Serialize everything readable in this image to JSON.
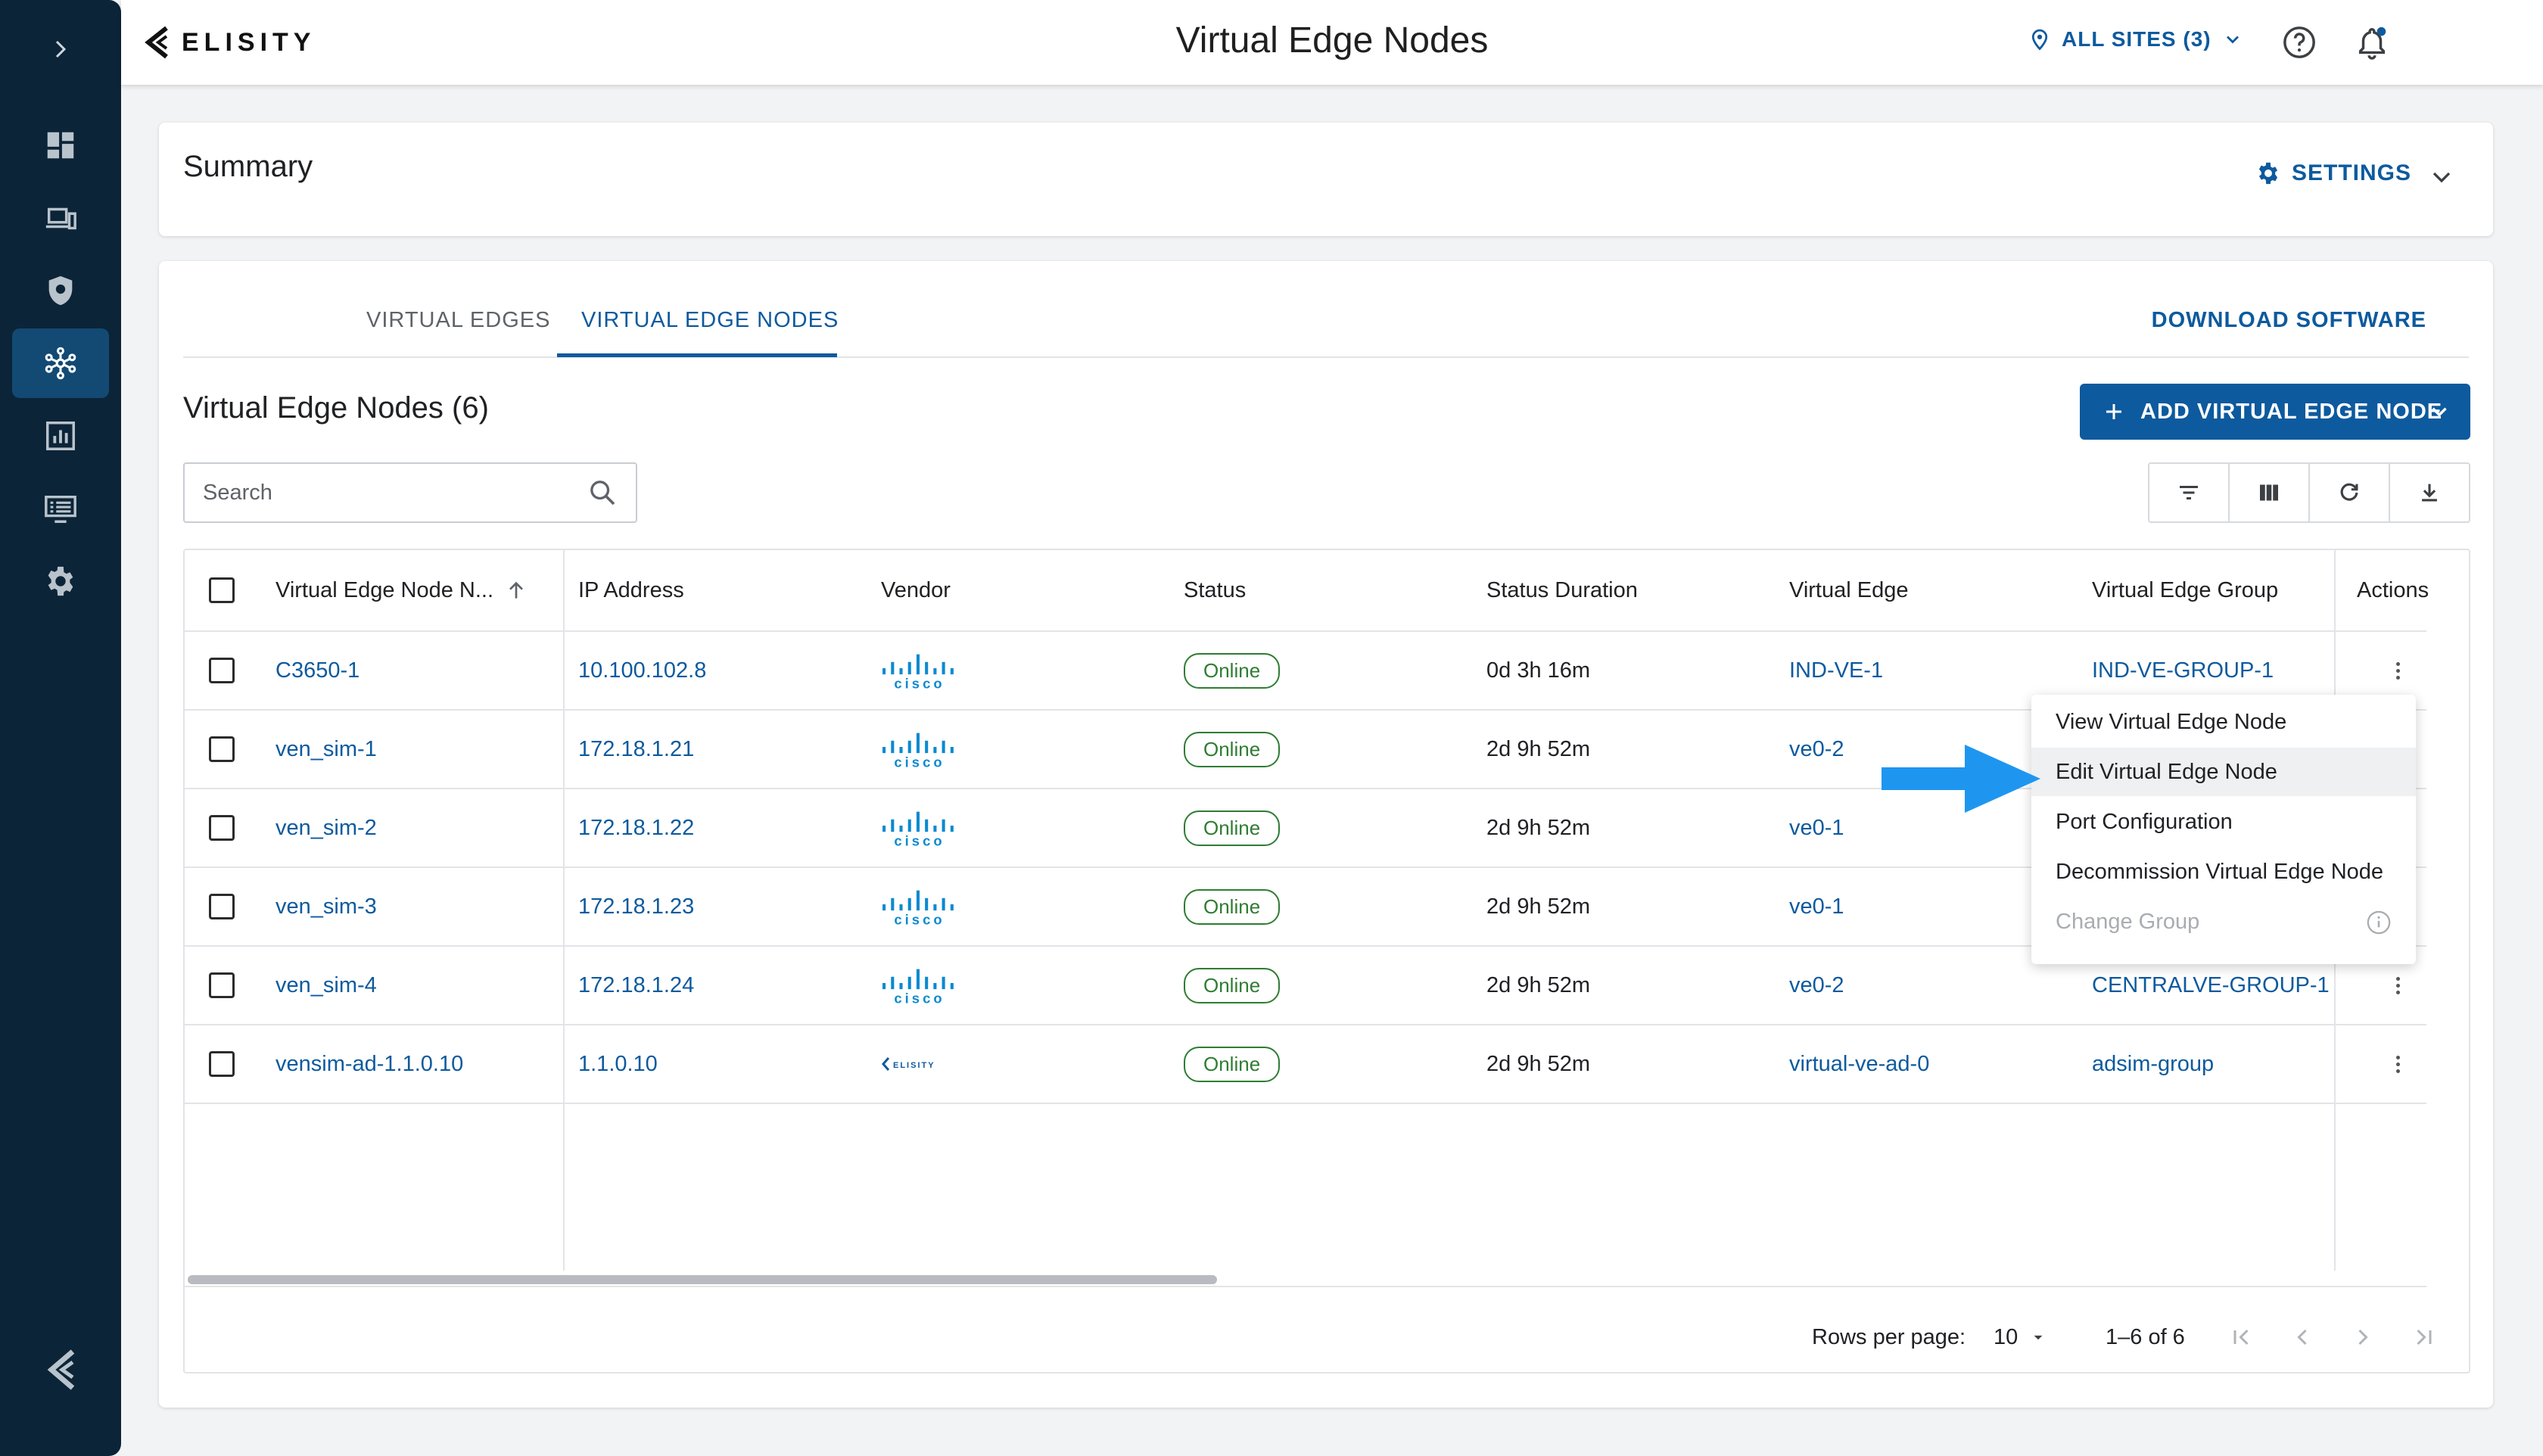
{
  "app": {
    "brand": "ELISITY",
    "page_title": "Virtual Edge Nodes",
    "sites_label": "ALL SITES (3)"
  },
  "sidebar": {
    "items": [
      {
        "name": "dashboard",
        "icon": "dashboard-icon",
        "active": false
      },
      {
        "name": "devices",
        "icon": "devices-icon",
        "active": false
      },
      {
        "name": "policies",
        "icon": "shield-icon",
        "active": false
      },
      {
        "name": "network",
        "icon": "network-icon",
        "active": true
      },
      {
        "name": "analytics",
        "icon": "analytics-icon",
        "active": false
      },
      {
        "name": "logs",
        "icon": "logs-icon",
        "active": false
      },
      {
        "name": "settings",
        "icon": "gear-icon",
        "active": false
      }
    ]
  },
  "summary": {
    "title": "Summary",
    "settings_label": "SETTINGS"
  },
  "tabs": [
    {
      "label": "VIRTUAL EDGES",
      "active": false
    },
    {
      "label": "VIRTUAL EDGE NODES",
      "active": true
    }
  ],
  "download_label": "DOWNLOAD SOFTWARE",
  "list": {
    "title": "Virtual Edge Nodes (6)",
    "add_button_label": "ADD VIRTUAL EDGE NODE",
    "search_placeholder": "Search"
  },
  "table": {
    "columns": [
      "Virtual Edge Node N...",
      "IP Address",
      "Vendor",
      "Status",
      "Status Duration",
      "Virtual Edge",
      "Virtual Edge Group",
      "Actions"
    ],
    "rows": [
      {
        "name": "C3650-1",
        "ip": "10.100.102.8",
        "vendor": "cisco",
        "status": "Online",
        "duration": "0d 3h 16m",
        "edge": "IND-VE-1",
        "group": "IND-VE-GROUP-1"
      },
      {
        "name": "ven_sim-1",
        "ip": "172.18.1.21",
        "vendor": "cisco",
        "status": "Online",
        "duration": "2d 9h 52m",
        "edge": "ve0-2",
        "group": ""
      },
      {
        "name": "ven_sim-2",
        "ip": "172.18.1.22",
        "vendor": "cisco",
        "status": "Online",
        "duration": "2d 9h 52m",
        "edge": "ve0-1",
        "group": ""
      },
      {
        "name": "ven_sim-3",
        "ip": "172.18.1.23",
        "vendor": "cisco",
        "status": "Online",
        "duration": "2d 9h 52m",
        "edge": "ve0-1",
        "group": ""
      },
      {
        "name": "ven_sim-4",
        "ip": "172.18.1.24",
        "vendor": "cisco",
        "status": "Online",
        "duration": "2d 9h 52m",
        "edge": "ve0-2",
        "group": "CENTRALVE-GROUP-1"
      },
      {
        "name": "vensim-ad-1.1.0.10",
        "ip": "1.1.0.10",
        "vendor": "elisity",
        "status": "Online",
        "duration": "2d 9h 52m",
        "edge": "virtual-ve-ad-0",
        "group": "adsim-group"
      }
    ]
  },
  "vendor_logos": {
    "cisco": "cisco",
    "elisity": "ELISITY"
  },
  "pagination": {
    "rows_per_page_label": "Rows per page:",
    "rows_per_page": "10",
    "range": "1–6 of 6"
  },
  "context_menu": {
    "items": [
      {
        "label": "View Virtual Edge Node",
        "hover": false,
        "disabled": false
      },
      {
        "label": "Edit Virtual Edge Node",
        "hover": true,
        "disabled": false
      },
      {
        "label": "Port Configuration",
        "hover": false,
        "disabled": false
      },
      {
        "label": "Decommission Virtual Edge Node",
        "hover": false,
        "disabled": false
      },
      {
        "label": "Change Group",
        "hover": false,
        "disabled": true
      }
    ]
  },
  "colors": {
    "sidebar": "#0c2438",
    "accent": "#0d5a9e",
    "online": "#2e7d32",
    "arrow": "#1e96f0"
  }
}
